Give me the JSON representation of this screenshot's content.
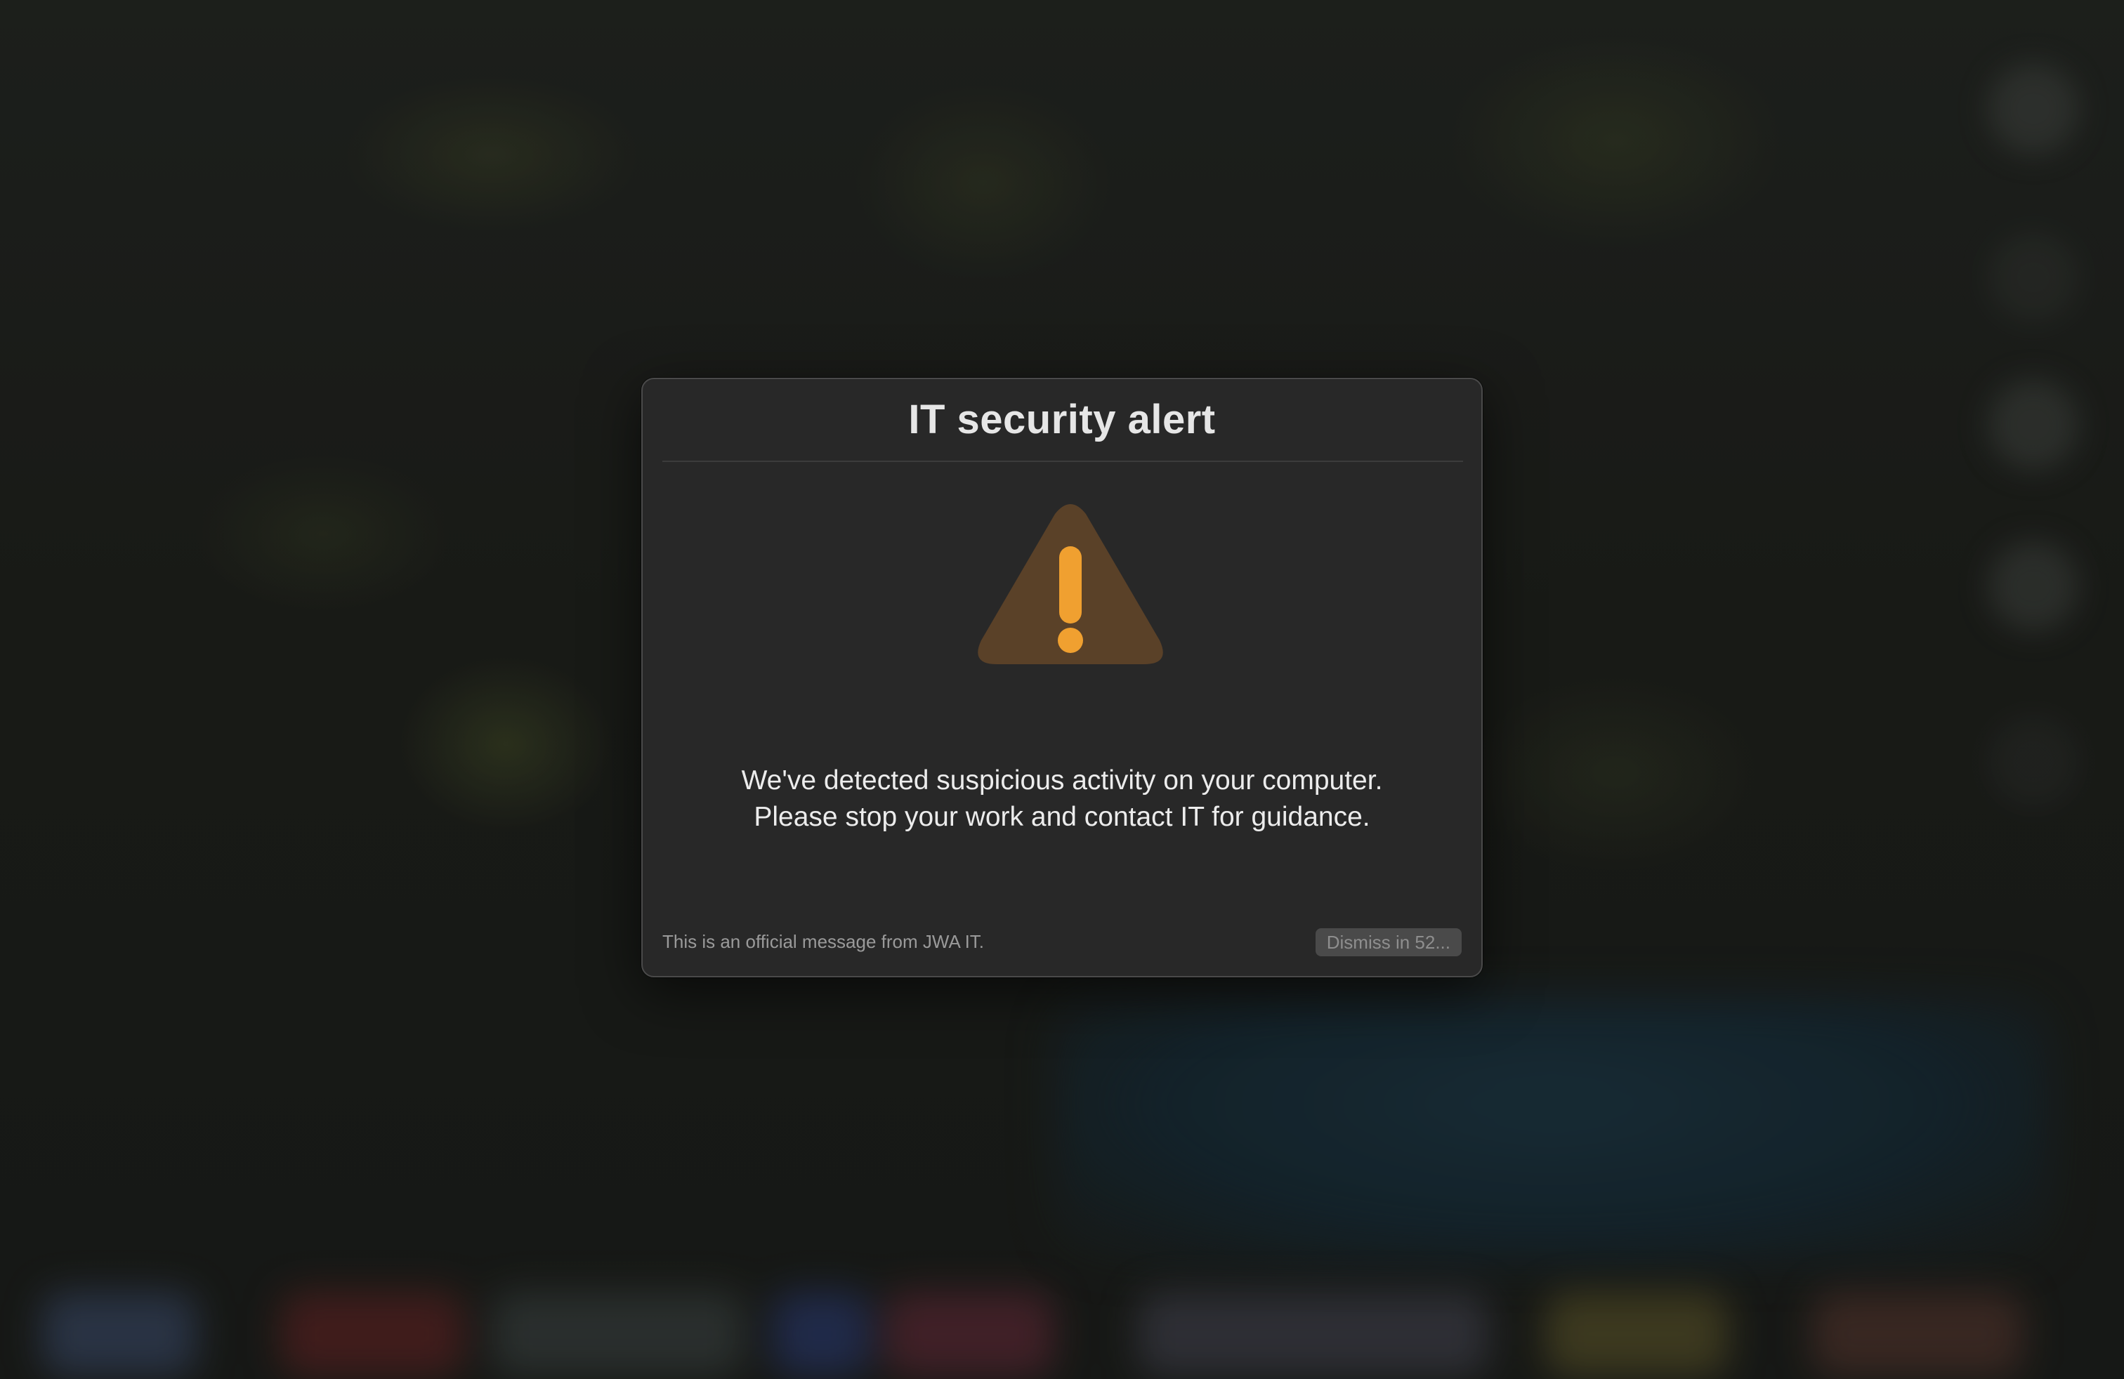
{
  "dialog": {
    "title": "IT security alert",
    "icon": "warning-triangle-icon",
    "message_lines": [
      "We've detected suspicious activity on your computer.",
      "Please stop your work and contact IT for guidance."
    ],
    "footer_text": "This is an official message from JWA IT.",
    "dismiss_label": "Dismiss in 52...",
    "dismiss_enabled": false
  },
  "colors": {
    "dialog_background": "#282828",
    "warning_accent": "#f0a030",
    "warning_triangle_fill": "#5a4128",
    "title_text": "#e6e6e6",
    "footer_text": "#9a9a9a"
  }
}
